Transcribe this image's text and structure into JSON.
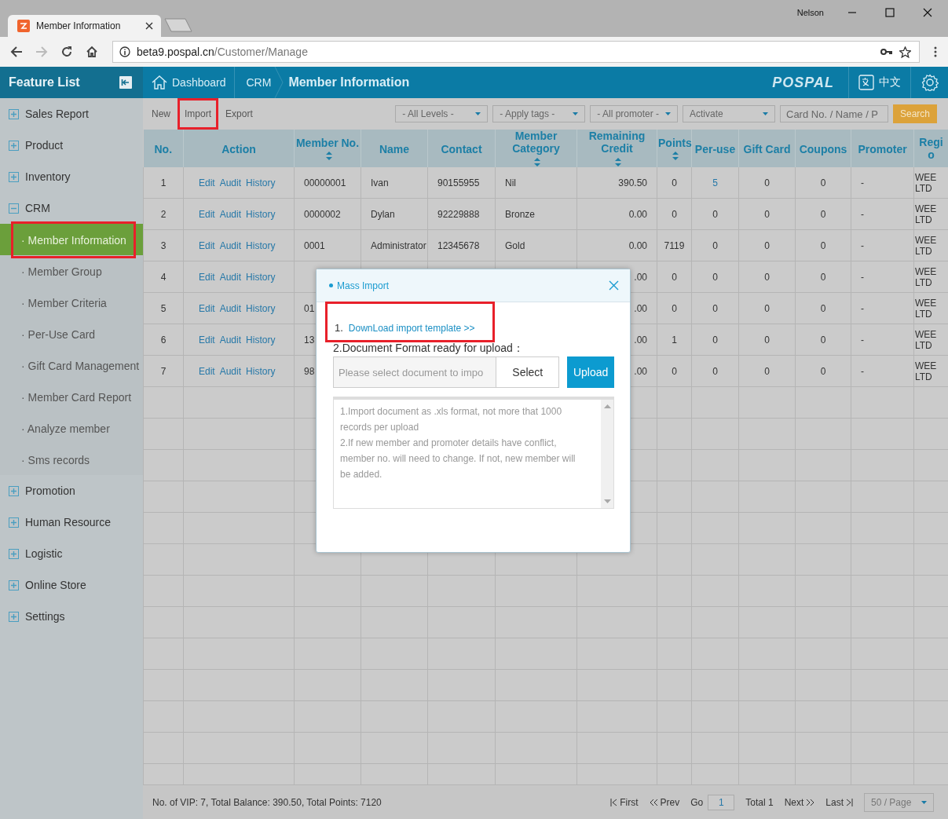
{
  "browser": {
    "tab": {
      "title": "Member Information"
    },
    "user": "Nelson",
    "address": {
      "host": "beta9.pospal.cn",
      "path": "/Customer/Manage"
    },
    "forward_disabled": true
  },
  "app_header": {
    "title": "Feature List",
    "breadcrumb": [
      {
        "label": "Dashboard",
        "kind": "home"
      },
      {
        "label": "CRM",
        "kind": "plain"
      },
      {
        "label": "Member Information",
        "kind": "current"
      }
    ],
    "logo": "POSPAL",
    "language": "中文"
  },
  "sidebar": {
    "items": [
      {
        "label": "Sales Report",
        "expanded": false
      },
      {
        "label": "Product",
        "expanded": false
      },
      {
        "label": "Inventory",
        "expanded": false
      },
      {
        "label": "CRM",
        "expanded": true,
        "children": [
          {
            "label": "· Member Information",
            "selected": true,
            "highlighted": true
          },
          {
            "label": "· Member Group",
            "selected": false,
            "highlighted": false
          },
          {
            "label": "· Member Criteria",
            "selected": false,
            "highlighted": false
          },
          {
            "label": "· Per-Use Card",
            "selected": false,
            "highlighted": false
          },
          {
            "label": "· Gift Card Management",
            "selected": false,
            "highlighted": false
          },
          {
            "label": "· Member Card Report",
            "selected": false,
            "highlighted": false
          },
          {
            "label": "· Analyze member",
            "selected": false,
            "highlighted": false
          },
          {
            "label": "· Sms records",
            "selected": false,
            "highlighted": false
          }
        ]
      },
      {
        "label": "Promotion",
        "expanded": false
      },
      {
        "label": "Human Resource",
        "expanded": false
      },
      {
        "label": "Logistic",
        "expanded": false
      },
      {
        "label": "Online Store",
        "expanded": false
      },
      {
        "label": "Settings",
        "expanded": false
      }
    ]
  },
  "toolbar": {
    "actions": [
      {
        "label": "New",
        "highlighted": false
      },
      {
        "label": "Import",
        "highlighted": true
      },
      {
        "label": "Export",
        "highlighted": false
      }
    ],
    "filters": [
      "- All Levels -",
      "- Apply tags -",
      "- All promoter -",
      "Activate"
    ],
    "search": {
      "placeholder": "Card No. / Name / P"
    },
    "search_button": "Search"
  },
  "table": {
    "columns": [
      {
        "label": "No.",
        "kind": "center",
        "sortable": false
      },
      {
        "label": "Action",
        "kind": "actions",
        "sortable": false
      },
      {
        "label": "Member No.",
        "kind": "left",
        "sortable": true
      },
      {
        "label": "Name",
        "kind": "left",
        "sortable": false
      },
      {
        "label": "Contact",
        "kind": "left",
        "sortable": false
      },
      {
        "label": "Member Category",
        "kind": "left",
        "sortable": true
      },
      {
        "label": "Remaining Credit",
        "kind": "right",
        "sortable": true
      },
      {
        "label": "Points",
        "kind": "center",
        "sortable": true
      },
      {
        "label": "Per-use",
        "kind": "center",
        "sortable": false
      },
      {
        "label": "Gift Card",
        "kind": "center",
        "sortable": false
      },
      {
        "label": "Coupons",
        "kind": "center",
        "sortable": false
      },
      {
        "label": "Promoter",
        "kind": "left",
        "sortable": false
      },
      {
        "label": "Regi o",
        "kind": "wrap",
        "sortable": false
      }
    ],
    "rows": [
      {
        "no": "1",
        "actions": [
          "Edit",
          "Audit",
          "History"
        ],
        "member_no": "00000001",
        "name": "Ivan",
        "contact": "90155955",
        "category": "Nil",
        "credit": "390.50",
        "points": "0",
        "per_use": {
          "text": "5",
          "link": true
        },
        "gift_card": "0",
        "coupons": "0",
        "promoter": "-",
        "column_13": "WEE LTD"
      },
      {
        "no": "2",
        "actions": [
          "Edit",
          "Audit",
          "History"
        ],
        "member_no": "0000002",
        "name": "Dylan",
        "contact": "92229888",
        "category": "Bronze",
        "credit": "0.00",
        "points": "0",
        "per_use": {
          "text": "0",
          "link": false
        },
        "gift_card": "0",
        "coupons": "0",
        "promoter": "-",
        "column_13": "WEE LTD"
      },
      {
        "no": "3",
        "actions": [
          "Edit",
          "Audit",
          "History"
        ],
        "member_no": "0001",
        "name": "Administrator",
        "contact": "12345678",
        "category": "Gold",
        "credit": "0.00",
        "points": "7119",
        "per_use": {
          "text": "0",
          "link": false
        },
        "gift_card": "0",
        "coupons": "0",
        "promoter": "-",
        "column_13": "WEE LTD"
      },
      {
        "no": "4",
        "actions": [
          "Edit",
          "Audit",
          "History"
        ],
        "credit": ".00",
        "points": "0",
        "per_use": {
          "text": "0",
          "link": false
        },
        "gift_card": "0",
        "coupons": "0",
        "promoter": "-",
        "column_13": "WEE LTD"
      },
      {
        "no": "5",
        "actions": [
          "Edit",
          "Audit",
          "History"
        ],
        "member_no": "01",
        "credit": ".00",
        "points": "0",
        "per_use": {
          "text": "0",
          "link": false
        },
        "gift_card": "0",
        "coupons": "0",
        "promoter": "-",
        "column_13": "WEE LTD"
      },
      {
        "no": "6",
        "actions": [
          "Edit",
          "Audit",
          "History"
        ],
        "member_no": "13",
        "credit": ".00",
        "points": "1",
        "per_use": {
          "text": "0",
          "link": false
        },
        "gift_card": "0",
        "coupons": "0",
        "promoter": "-",
        "column_13": "WEE LTD"
      },
      {
        "no": "7",
        "actions": [
          "Edit",
          "Audit",
          "History"
        ],
        "member_no": "98",
        "credit": ".00",
        "points": "0",
        "per_use": {
          "text": "0",
          "link": false
        },
        "gift_card": "0",
        "coupons": "0",
        "promoter": "-",
        "column_13": "WEE LTD"
      }
    ]
  },
  "footer": {
    "summary": "No. of VIP: 7, Total Balance: 390.50, Total Points: 7120",
    "first": "First",
    "prev": "Prev",
    "go": "Go",
    "page": "1",
    "total": "Total 1",
    "next": "Next",
    "last": "Last",
    "page_size": "50 / Page"
  },
  "dialog": {
    "title": "Mass Import",
    "step1_number": "1.",
    "download_link": "DownLoad import template >>",
    "link_highlighted": true,
    "step2": "2.Document Format ready for upload：",
    "file_placeholder": "Please select document to impo",
    "select_button": "Select",
    "upload_button": "Upload",
    "notes": [
      "1.Import document as .xls format, not more that 1000 records per upload",
      "2.If new member and promoter details have conflict, member no. will need to change. If not, new member will be added."
    ]
  }
}
